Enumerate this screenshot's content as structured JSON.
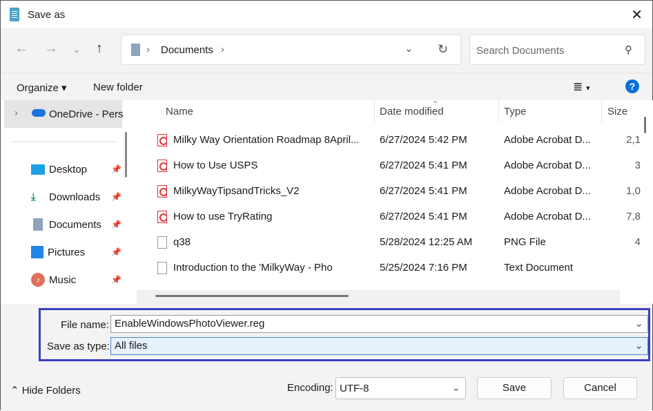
{
  "title": "Save as",
  "nav": {
    "breadcrumb": "Documents",
    "search_placeholder": "Search Documents"
  },
  "toolbar": {
    "organize": "Organize",
    "new_folder": "New folder",
    "help": "?"
  },
  "sidebar": {
    "items": [
      {
        "label": "OneDrive - Pers"
      },
      {
        "label": "Desktop"
      },
      {
        "label": "Downloads"
      },
      {
        "label": "Documents"
      },
      {
        "label": "Pictures"
      },
      {
        "label": "Music"
      }
    ]
  },
  "columns": {
    "name": "Name",
    "date": "Date modified",
    "type": "Type",
    "size": "Size"
  },
  "files": [
    {
      "name": "Milky Way Orientation Roadmap 8April...",
      "date": "6/27/2024 5:42 PM",
      "type": "Adobe Acrobat D...",
      "size": "2,1",
      "kind": "pdf"
    },
    {
      "name": "How to Use USPS",
      "date": "6/27/2024 5:41 PM",
      "type": "Adobe Acrobat D...",
      "size": "3",
      "kind": "pdf"
    },
    {
      "name": "MilkyWayTipsandTricks_V2",
      "date": "6/27/2024 5:41 PM",
      "type": "Adobe Acrobat D...",
      "size": "1,0",
      "kind": "pdf"
    },
    {
      "name": "How to use TryRating",
      "date": "6/27/2024 5:41 PM",
      "type": "Adobe Acrobat D...",
      "size": "7,8",
      "kind": "pdf"
    },
    {
      "name": "q38",
      "date": "5/28/2024 12:25 AM",
      "type": "PNG File",
      "size": "4",
      "kind": "png"
    },
    {
      "name": "Introduction to the 'MilkyWay - Pho",
      "date": "5/25/2024 7:16 PM",
      "type": "Text Document",
      "size": "",
      "kind": "txt"
    }
  ],
  "form": {
    "file_name_label": "File name:",
    "file_name": "EnableWindowsPhotoViewer.reg",
    "type_label": "Save as type:",
    "type_value": "All files"
  },
  "footer": {
    "hide_folders": "Hide Folders",
    "encoding_label": "Encoding:",
    "encoding": "UTF-8",
    "save": "Save",
    "cancel": "Cancel"
  },
  "colors": {
    "accent": "#3b3fbf",
    "help": "#0a6fd6"
  }
}
